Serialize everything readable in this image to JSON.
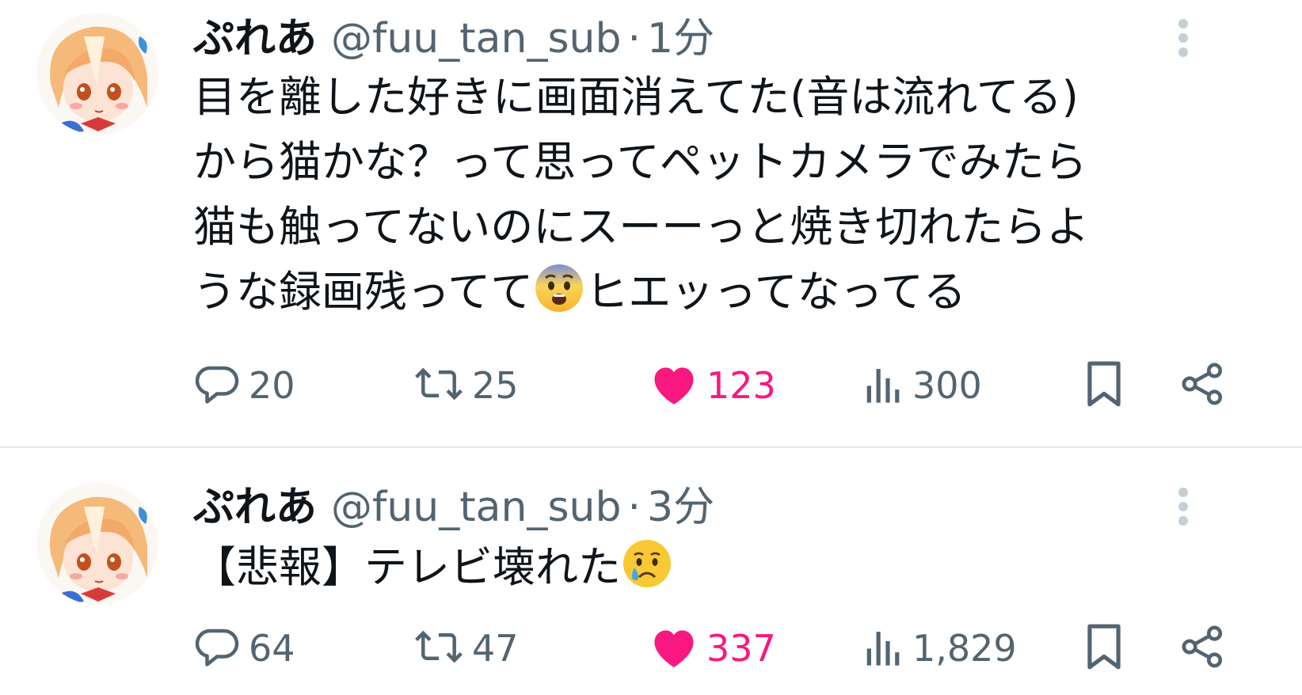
{
  "tweets": [
    {
      "display_name": "ぷれあ",
      "handle": "@fuu_tan_sub",
      "separator": "·",
      "time": "1分",
      "body_lines": [
        "目を離した好きに画面消えてた(音は流れてる)",
        "から猫かな？って思ってペットカメラでみたら",
        "猫も触ってないのにスーーっと焼き切れたらよ",
        "うな録画残ってて"
      ],
      "body_after_emoji": "ヒエッってなってる",
      "emoji": "fearful-face-emoji",
      "replies": "20",
      "retweets": "25",
      "likes": "123",
      "views": "300"
    },
    {
      "display_name": "ぷれあ",
      "handle": "@fuu_tan_sub",
      "separator": "·",
      "time": "3分",
      "body_text": "【悲報】テレビ壊れた",
      "emoji": "crying-face-emoji",
      "replies": "64",
      "retweets": "47",
      "likes": "337",
      "views": "1,829"
    }
  ],
  "colors": {
    "text": "#0f1419",
    "muted": "#536471",
    "like": "#f91880",
    "divider": "#e7e9ea"
  }
}
